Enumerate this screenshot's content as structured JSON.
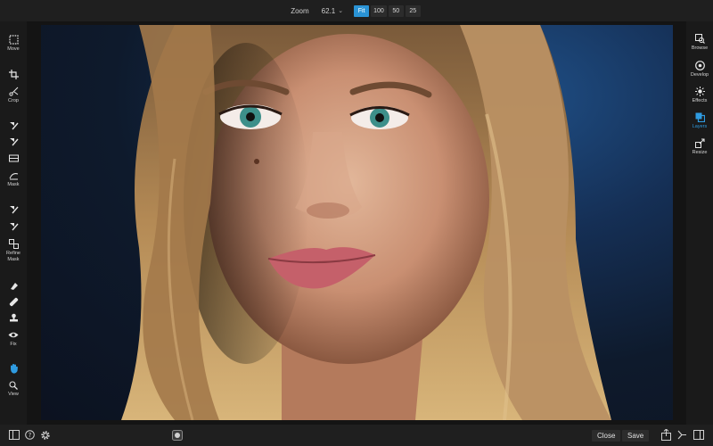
{
  "zoom": {
    "label": "Zoom",
    "value": "62.1",
    "presets": [
      "Fit",
      "100",
      "50",
      "25"
    ],
    "active_preset": "Fit"
  },
  "left_tools": {
    "move": "Move",
    "crop": "Crop",
    "mask": "Mask",
    "refine_mask_line1": "Refine",
    "refine_mask_line2": "Mask",
    "fix": "Fix",
    "view": "View"
  },
  "right_panel": {
    "browse": "Browse",
    "develop": "Develop",
    "effects": "Effects",
    "layers": "Layers",
    "resize": "Resize",
    "active": "Layers"
  },
  "bottom": {
    "close_label": "Close",
    "save_label": "Save"
  },
  "colors": {
    "accent": "#2a93d5",
    "panel": "#1a1a1a",
    "bar": "#1f1f1f"
  }
}
